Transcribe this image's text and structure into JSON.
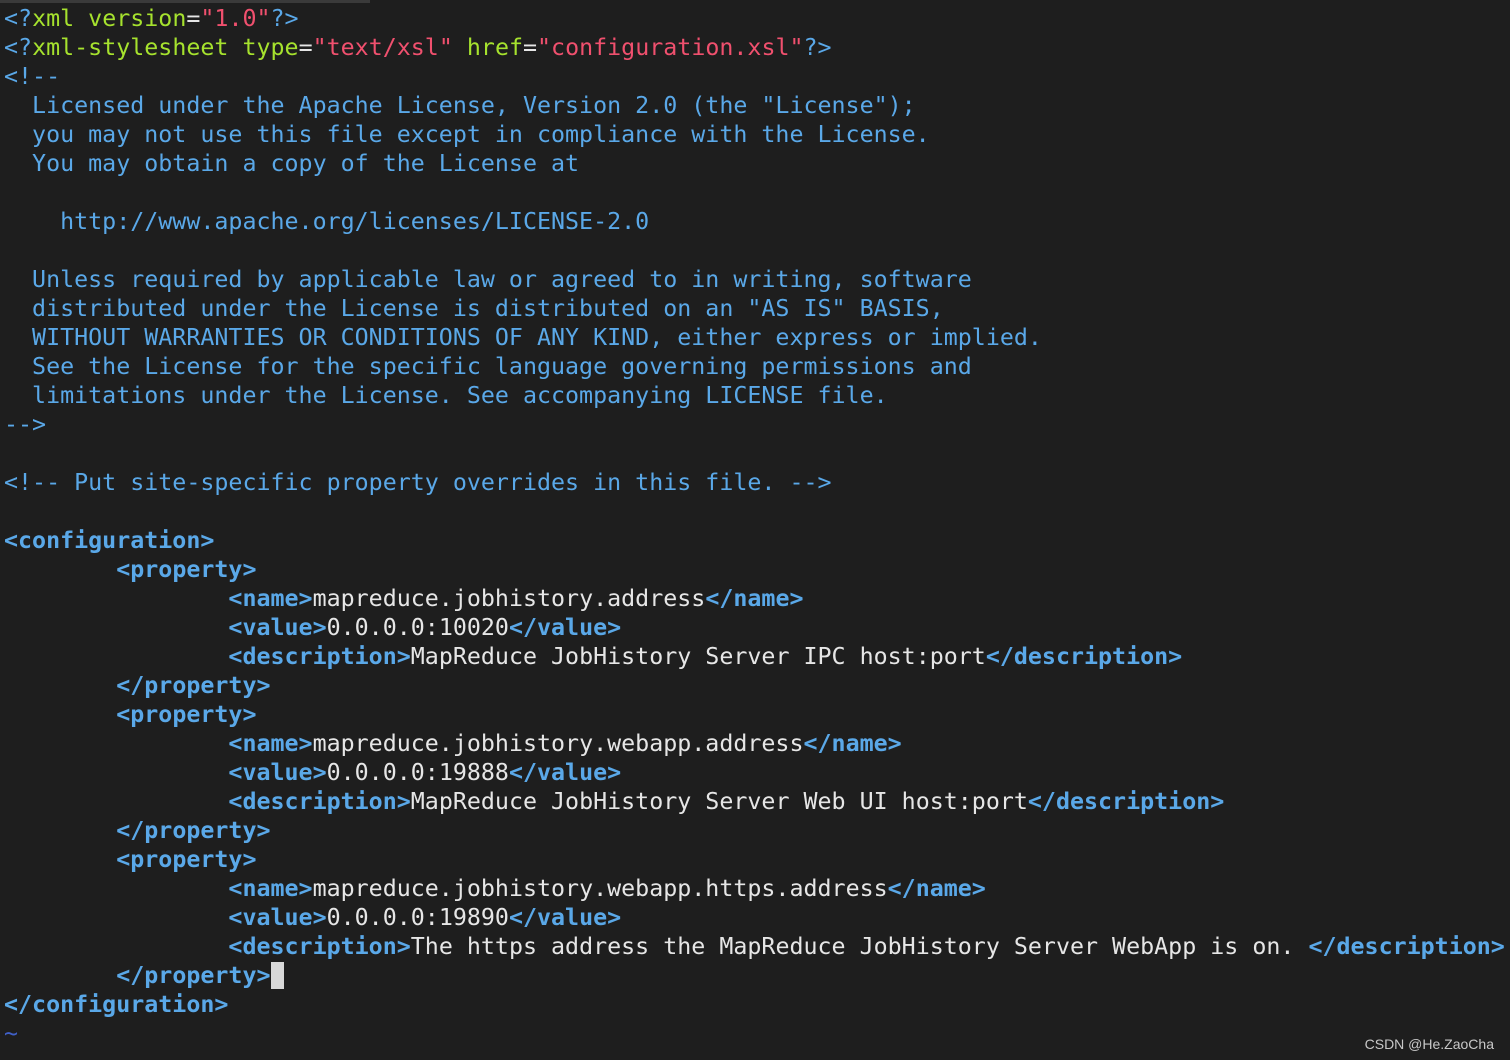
{
  "editor": {
    "lines": [
      [
        [
          "pi",
          "<?"
        ],
        [
          "an",
          "xml version"
        ],
        [
          "x",
          "="
        ],
        [
          "av",
          "\"1.0\""
        ],
        [
          "pi",
          "?>"
        ]
      ],
      [
        [
          "pi",
          "<?"
        ],
        [
          "an",
          "xml-stylesheet type"
        ],
        [
          "x",
          "="
        ],
        [
          "av",
          "\"text/xsl\""
        ],
        [
          "x",
          " "
        ],
        [
          "an",
          "href"
        ],
        [
          "x",
          "="
        ],
        [
          "av",
          "\"configuration.xsl\""
        ],
        [
          "pi",
          "?>"
        ]
      ],
      [
        [
          "c",
          "<!--"
        ]
      ],
      [
        [
          "c",
          "  Licensed under the Apache License, Version 2.0 (the \"License\");"
        ]
      ],
      [
        [
          "c",
          "  you may not use this file except in compliance with the License."
        ]
      ],
      [
        [
          "c",
          "  You may obtain a copy of the License at"
        ]
      ],
      [
        [
          "c",
          ""
        ]
      ],
      [
        [
          "c",
          "    http://www.apache.org/licenses/LICENSE-2.0"
        ]
      ],
      [
        [
          "c",
          ""
        ]
      ],
      [
        [
          "c",
          "  Unless required by applicable law or agreed to in writing, software"
        ]
      ],
      [
        [
          "c",
          "  distributed under the License is distributed on an \"AS IS\" BASIS,"
        ]
      ],
      [
        [
          "c",
          "  WITHOUT WARRANTIES OR CONDITIONS OF ANY KIND, either express or implied."
        ]
      ],
      [
        [
          "c",
          "  See the License for the specific language governing permissions and"
        ]
      ],
      [
        [
          "c",
          "  limitations under the License. See accompanying LICENSE file."
        ]
      ],
      [
        [
          "c",
          "-->"
        ]
      ],
      [
        [
          "x",
          ""
        ]
      ],
      [
        [
          "c",
          "<!-- Put site-specific property overrides in this file. -->"
        ]
      ],
      [
        [
          "x",
          ""
        ]
      ],
      [
        [
          "t",
          "<configuration>"
        ]
      ],
      [
        [
          "x",
          "        "
        ],
        [
          "t",
          "<property>"
        ]
      ],
      [
        [
          "x",
          "                "
        ],
        [
          "t",
          "<name>"
        ],
        [
          "x",
          "mapreduce.jobhistory.address"
        ],
        [
          "t",
          "</name>"
        ]
      ],
      [
        [
          "x",
          "                "
        ],
        [
          "t",
          "<value>"
        ],
        [
          "x",
          "0.0.0.0:10020"
        ],
        [
          "t",
          "</value>"
        ]
      ],
      [
        [
          "x",
          "                "
        ],
        [
          "t",
          "<description>"
        ],
        [
          "x",
          "MapReduce JobHistory Server IPC host:port"
        ],
        [
          "t",
          "</description>"
        ]
      ],
      [
        [
          "x",
          "        "
        ],
        [
          "t",
          "</property>"
        ]
      ],
      [
        [
          "x",
          "        "
        ],
        [
          "t",
          "<property>"
        ]
      ],
      [
        [
          "x",
          "                "
        ],
        [
          "t",
          "<name>"
        ],
        [
          "x",
          "mapreduce.jobhistory.webapp.address"
        ],
        [
          "t",
          "</name>"
        ]
      ],
      [
        [
          "x",
          "                "
        ],
        [
          "t",
          "<value>"
        ],
        [
          "x",
          "0.0.0.0:19888"
        ],
        [
          "t",
          "</value>"
        ]
      ],
      [
        [
          "x",
          "                "
        ],
        [
          "t",
          "<description>"
        ],
        [
          "x",
          "MapReduce JobHistory Server Web UI host:port"
        ],
        [
          "t",
          "</description>"
        ]
      ],
      [
        [
          "x",
          "        "
        ],
        [
          "t",
          "</property>"
        ]
      ],
      [
        [
          "x",
          "        "
        ],
        [
          "t",
          "<property>"
        ]
      ],
      [
        [
          "x",
          "                "
        ],
        [
          "t",
          "<name>"
        ],
        [
          "x",
          "mapreduce.jobhistory.webapp.https.address"
        ],
        [
          "t",
          "</name>"
        ]
      ],
      [
        [
          "x",
          "                "
        ],
        [
          "t",
          "<value>"
        ],
        [
          "x",
          "0.0.0.0:19890"
        ],
        [
          "t",
          "</value>"
        ]
      ],
      [
        [
          "x",
          "                "
        ],
        [
          "t",
          "<description>"
        ],
        [
          "x",
          "The https address the MapReduce JobHistory Server WebApp is on. "
        ],
        [
          "t",
          "</description>"
        ]
      ],
      [
        [
          "x",
          "        "
        ],
        [
          "t",
          "</property>"
        ],
        [
          "cursor",
          ""
        ]
      ],
      [
        [
          "t",
          "</configuration>"
        ]
      ],
      [
        [
          "tilde",
          "~"
        ]
      ]
    ]
  },
  "watermark": "CSDN @He.ZaoCha",
  "colors": {
    "background": "#1e1e1e",
    "comment": "#5aa8e8",
    "tag": "#5aa8e8",
    "attribute_name": "#a6e22e",
    "attribute_value": "#f0506e",
    "text": "#e6e6e6"
  }
}
